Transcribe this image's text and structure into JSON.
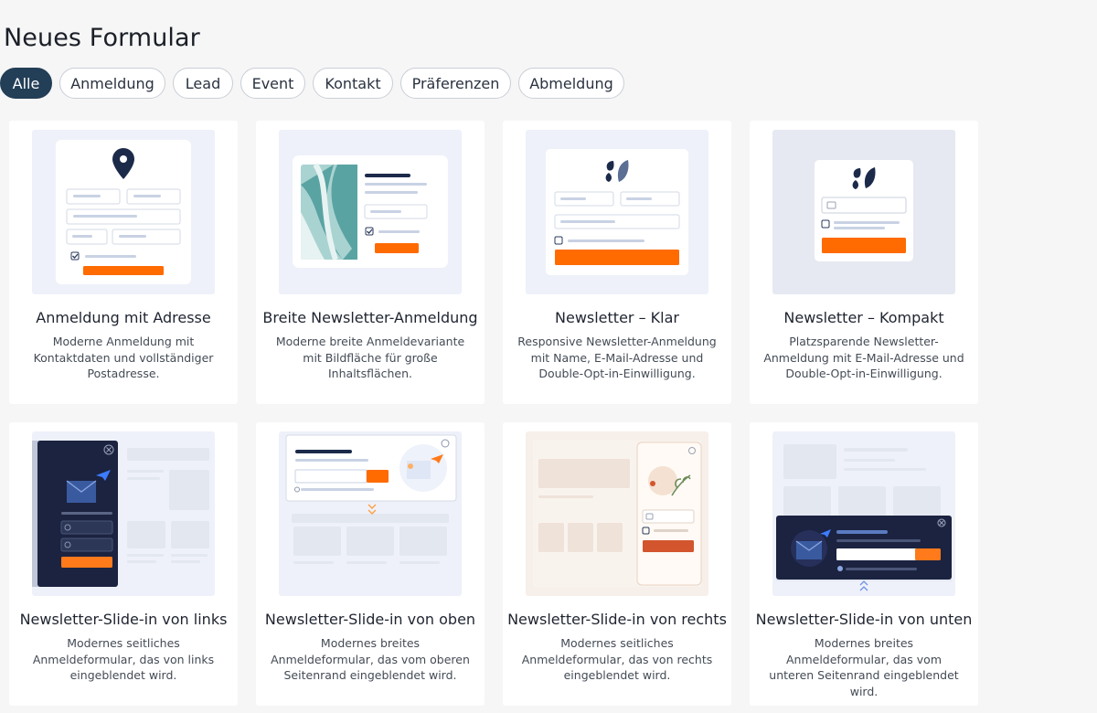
{
  "page": {
    "title": "Neues Formular"
  },
  "filters": [
    {
      "label": "Alle",
      "active": true
    },
    {
      "label": "Anmeldung",
      "active": false
    },
    {
      "label": "Lead",
      "active": false
    },
    {
      "label": "Event",
      "active": false
    },
    {
      "label": "Kontakt",
      "active": false
    },
    {
      "label": "Präferenzen",
      "active": false
    },
    {
      "label": "Abmeldung",
      "active": false
    }
  ],
  "templates": [
    {
      "title": "Anmeldung mit Adresse",
      "description": "Moderne Anmeldung mit Kontaktdaten und vollständiger Postadresse."
    },
    {
      "title": "Breite Newsletter-Anmeldung",
      "description": "Moderne breite Anmeldevariante mit Bildfläche für große Inhaltsflächen."
    },
    {
      "title": "Newsletter – Klar",
      "description": "Responsive Newsletter-Anmeldung mit Name, E-Mail-Adresse und Double-Opt-in-Einwilligung."
    },
    {
      "title": "Newsletter – Kompakt",
      "description": "Platzsparende Newsletter-Anmeldung mit E-Mail-Adresse und Double-Opt-in-Einwilligung."
    },
    {
      "title": "Newsletter-Slide-in von links",
      "description": "Modernes seitliches Anmeldeformular, das von links eingeblendet wird."
    },
    {
      "title": "Newsletter-Slide-in von oben",
      "description": "Modernes breites Anmeldeformular, das vom oberen Seitenrand eingeblendet wird."
    },
    {
      "title": "Newsletter-Slide-in von rechts",
      "description": "Modernes seitliches Anmeldeformular, das von rechts eingeblendet wird."
    },
    {
      "title": "Newsletter-Slide-in von unten",
      "description": "Modernes breites Anmeldeformular, das vom unteren Seitenrand eingeblendet wird."
    }
  ],
  "colors": {
    "accent": "#ff6b00",
    "navy": "#1c2a4a",
    "chip_active": "#233e57"
  }
}
